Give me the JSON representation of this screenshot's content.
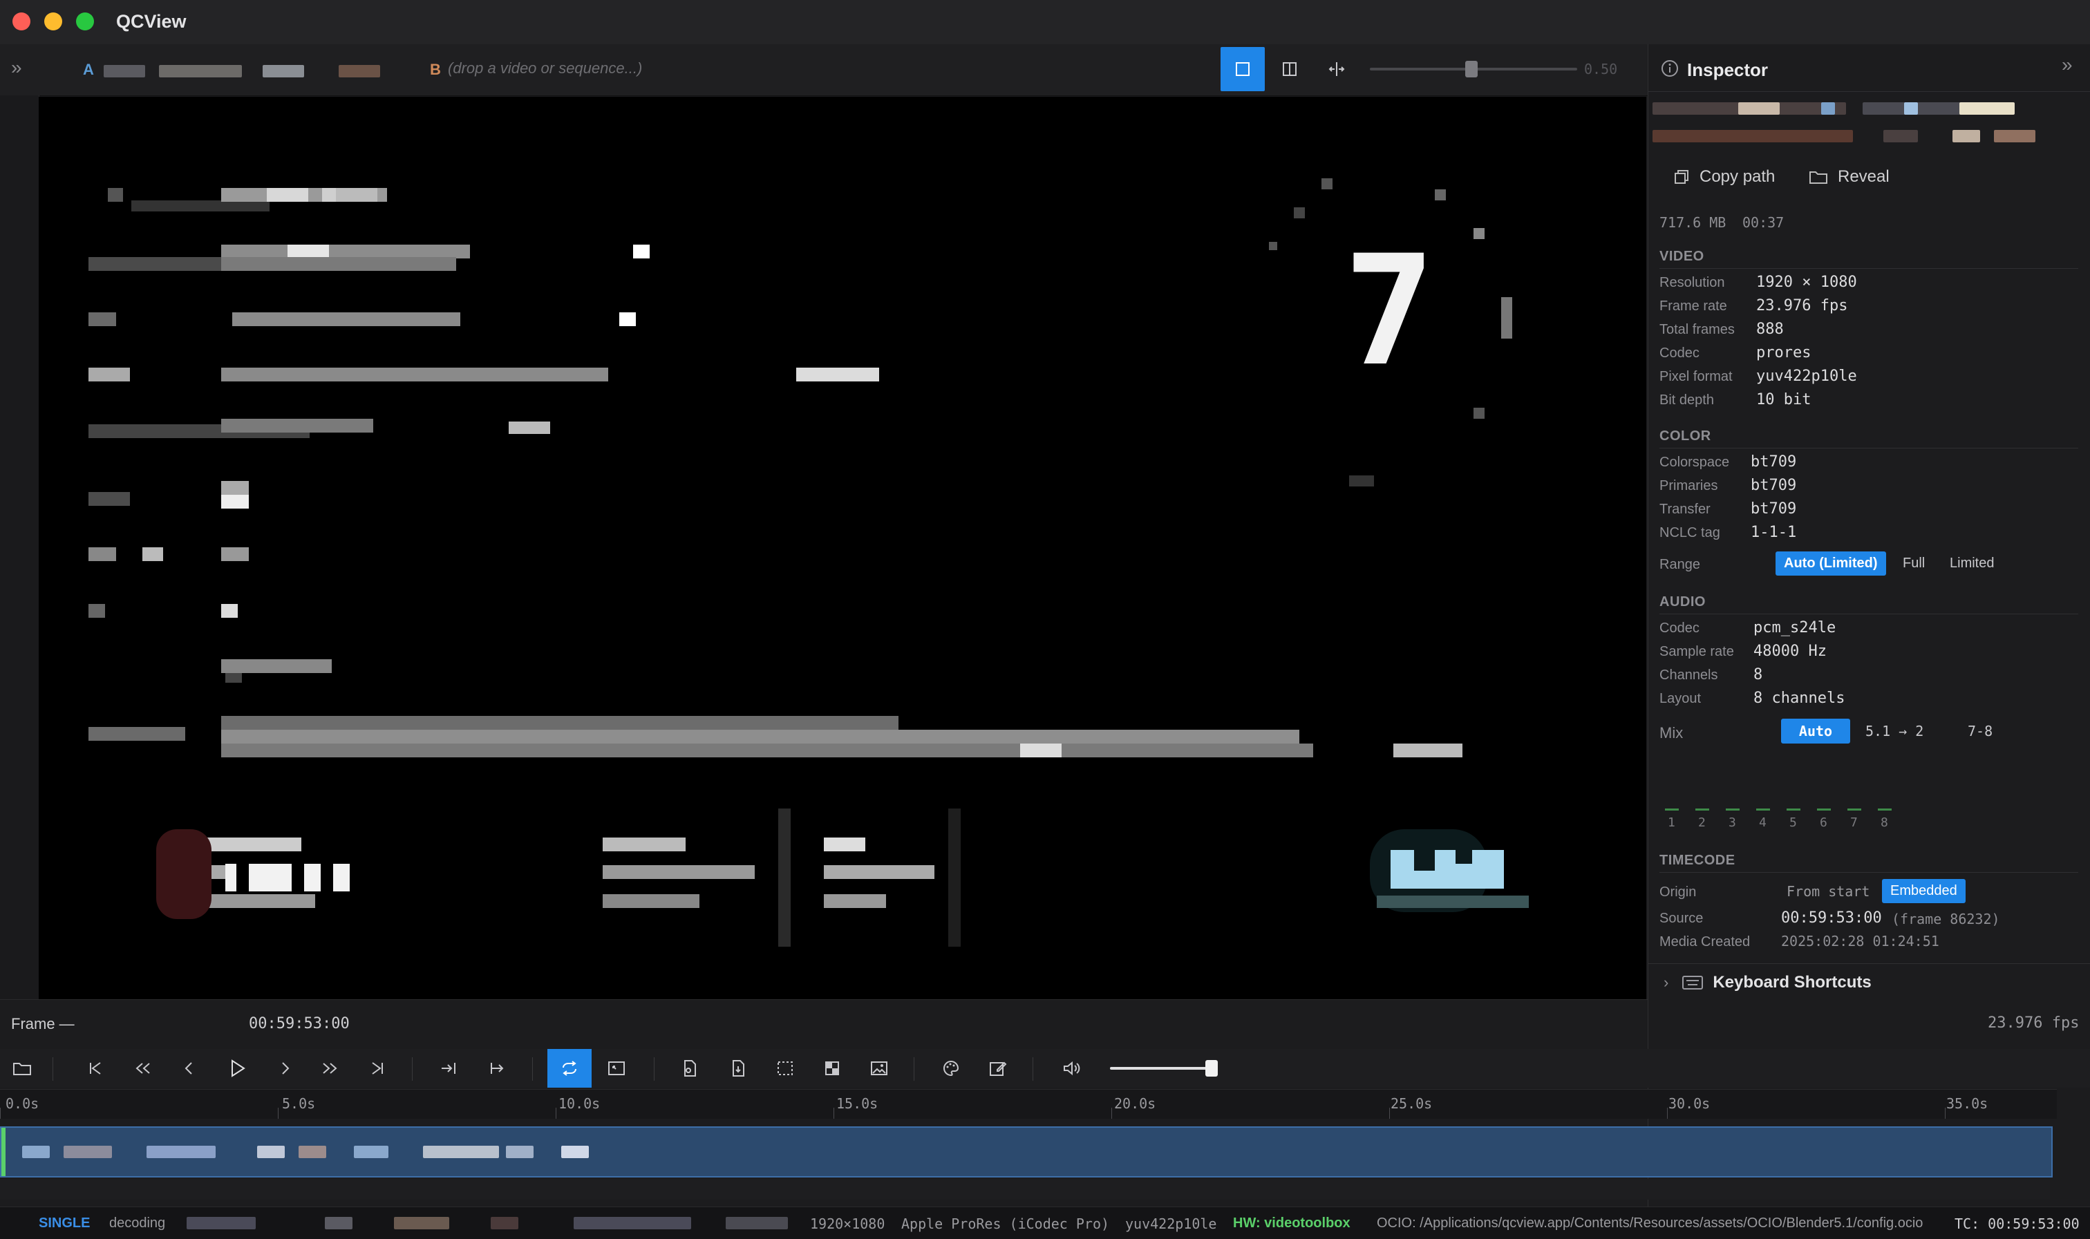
{
  "window": {
    "title": "QCView"
  },
  "toolbar": {
    "source_a_label": "A",
    "source_b_label": "B",
    "source_b_placeholder": "(drop a video or sequence...)",
    "wipe_value": "0.50"
  },
  "inspector": {
    "title": "Inspector",
    "copy_path": "Copy path",
    "reveal": "Reveal",
    "file_size": "717.6 MB",
    "duration": "00:37",
    "video": {
      "heading": "VIDEO",
      "rows": [
        {
          "key": "Resolution",
          "value": "1920 × 1080"
        },
        {
          "key": "Frame rate",
          "value": "23.976 fps"
        },
        {
          "key": "Total frames",
          "value": "888"
        },
        {
          "key": "Codec",
          "value": "prores"
        },
        {
          "key": "Pixel format",
          "value": "yuv422p10le"
        },
        {
          "key": "Bit depth",
          "value": "10 bit"
        }
      ]
    },
    "color": {
      "heading": "COLOR",
      "rows": [
        {
          "key": "Colorspace",
          "value": "bt709"
        },
        {
          "key": "Primaries",
          "value": "bt709"
        },
        {
          "key": "Transfer",
          "value": "bt709"
        },
        {
          "key": "NCLC tag",
          "value": "1-1-1"
        }
      ],
      "range_label": "Range",
      "range_options": [
        "Auto (Limited)",
        "Full",
        "Limited"
      ]
    },
    "audio": {
      "heading": "AUDIO",
      "rows": [
        {
          "key": "Codec",
          "value": "pcm_s24le"
        },
        {
          "key": "Sample rate",
          "value": "48000 Hz"
        },
        {
          "key": "Channels",
          "value": "8"
        },
        {
          "key": "Layout",
          "value": "8 channels"
        }
      ],
      "mix_label": "Mix",
      "mix_options": [
        "Auto",
        "5.1 → 2",
        "7-8"
      ],
      "channel_numbers": [
        "1",
        "2",
        "3",
        "4",
        "5",
        "6",
        "7",
        "8"
      ]
    },
    "timecode": {
      "heading": "TIMECODE",
      "origin_label": "Origin",
      "origin_options": [
        "From start",
        "Embedded"
      ],
      "source_label": "Source",
      "source_value": "00:59:53:00",
      "source_frame": "(frame 86232)",
      "media_created_label": "Media Created",
      "media_created_value": "2025:02:28 01:24:51"
    },
    "keyboard_shortcuts": "Keyboard Shortcuts"
  },
  "framebar": {
    "frame_label": "Frame —",
    "timecode": "00:59:53:00",
    "fps": "23.976 fps"
  },
  "ruler": {
    "labels": [
      "0.0s",
      "5.0s",
      "10.0s",
      "15.0s",
      "20.0s",
      "25.0s",
      "30.0s",
      "35.0s"
    ]
  },
  "status": {
    "mode": "SINGLE",
    "decoding": "decoding",
    "resolution": "1920×1080",
    "codec": "Apple ProRes (iCodec Pro)",
    "pixfmt": "yuv422p10le",
    "hw": "HW: videotoolbox",
    "ocio": "OCIO: /Applications/qcview.app/Contents/Resources/assets/OCIO/Blender5.1/config.ocio",
    "tc": "TC: 00:59:53:00"
  },
  "viewer": {
    "overlay_digit": "7"
  },
  "colors": {
    "accent": "#1f86e8",
    "hw_green": "#5bd06a",
    "mode_blue": "#3a8ee6"
  }
}
